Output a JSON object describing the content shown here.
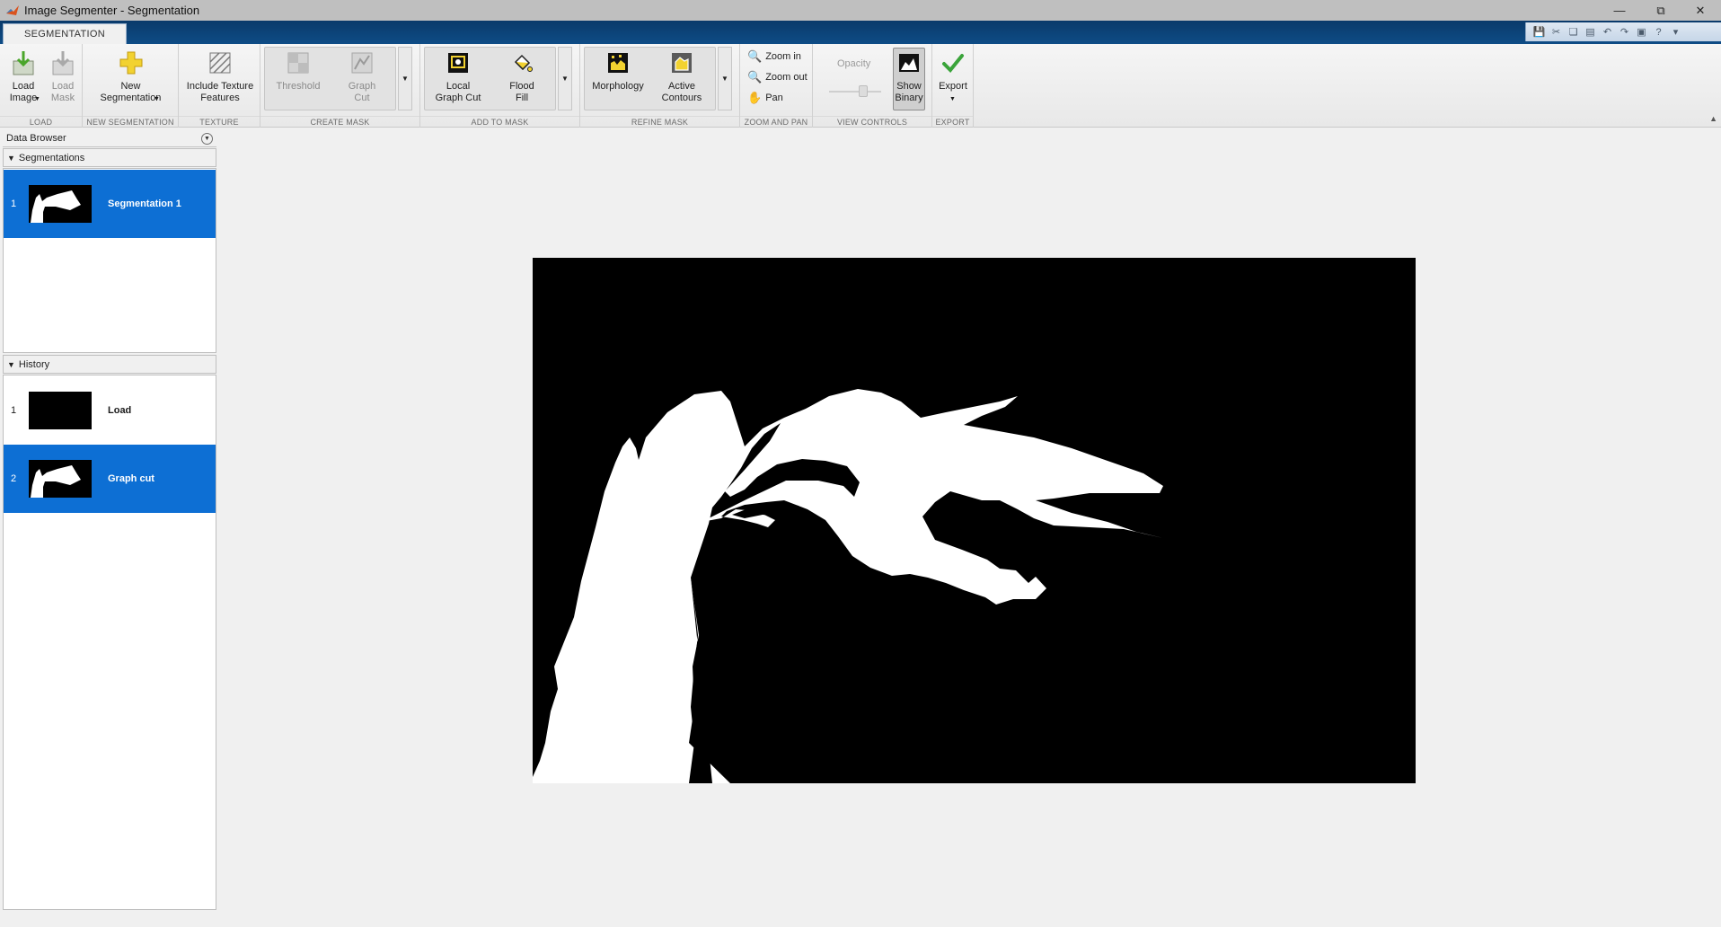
{
  "window": {
    "title": "Image Segmenter - Segmentation",
    "controls": [
      "minimize",
      "restore",
      "close"
    ]
  },
  "ribbon": {
    "active_tab": "SEGMENTATION",
    "quick_access": [
      "save-icon",
      "cut-icon",
      "copy-icon",
      "paste-icon",
      "undo-icon",
      "redo-icon",
      "switch-windows-icon",
      "help-icon"
    ],
    "sections": {
      "load": {
        "label": "LOAD",
        "load_image": "Load\nImage",
        "load_mask": "Load\nMask"
      },
      "new_segmentation": {
        "label": "NEW SEGMENTATION",
        "button": "New\nSegmentation"
      },
      "texture": {
        "label": "TEXTURE",
        "button": "Include Texture\nFeatures"
      },
      "create_mask": {
        "label": "CREATE MASK",
        "threshold": "Threshold",
        "graph_cut": "Graph\nCut"
      },
      "add_to_mask": {
        "label": "ADD TO MASK",
        "local_graph_cut": "Local\nGraph Cut",
        "flood_fill": "Flood\nFill"
      },
      "refine_mask": {
        "label": "REFINE MASK",
        "morphology": "Morphology",
        "active_contours": "Active\nContours"
      },
      "zoom_and_pan": {
        "label": "ZOOM AND PAN",
        "zoom_in": "Zoom in",
        "zoom_out": "Zoom out",
        "pan": "Pan"
      },
      "view_controls": {
        "label": "VIEW CONTROLS",
        "opacity": "Opacity",
        "show_binary": "Show\nBinary"
      },
      "export": {
        "label": "EXPORT",
        "button": "Export"
      }
    }
  },
  "data_browser": {
    "title": "Data Browser",
    "segmentations": {
      "header": "Segmentations",
      "items": [
        {
          "index": "1",
          "label": "Segmentation 1",
          "selected": true
        }
      ]
    },
    "history": {
      "header": "History",
      "items": [
        {
          "index": "1",
          "label": "Load",
          "selected": false
        },
        {
          "index": "2",
          "label": "Graph cut",
          "selected": true
        }
      ]
    }
  },
  "colors": {
    "selection": "#0d6fd4",
    "ribbon_tabstrip": "#0e4c86",
    "mask_foreground": "#ffffff",
    "mask_background": "#000000"
  }
}
